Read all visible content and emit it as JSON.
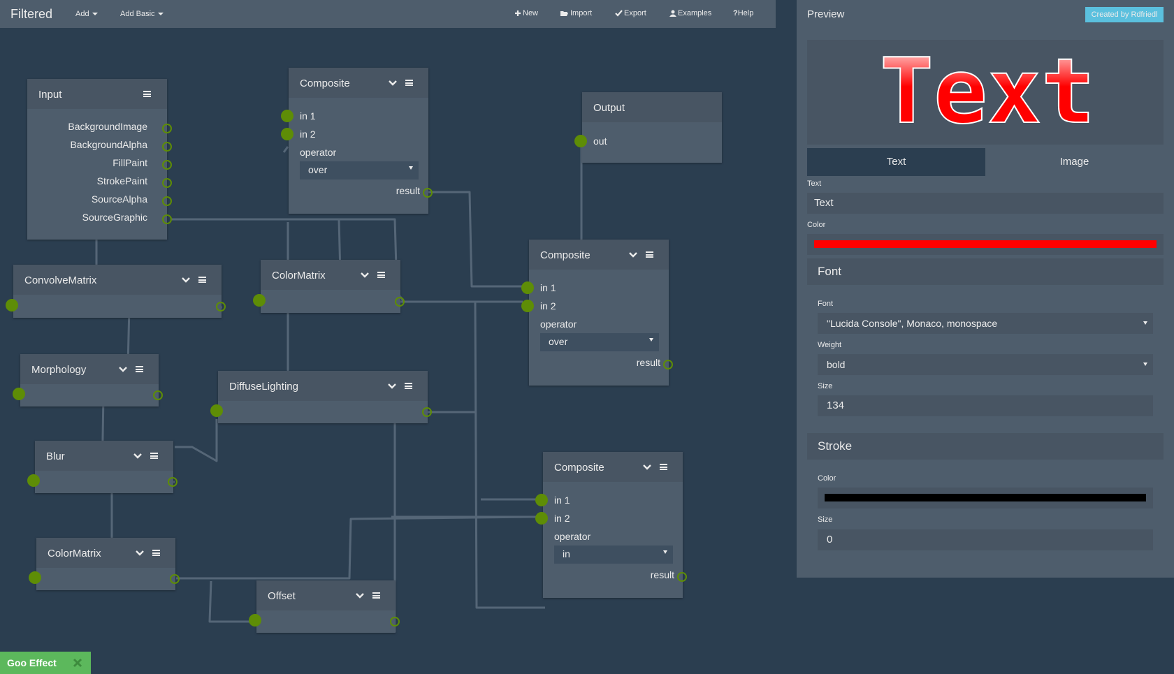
{
  "app": {
    "title": "Filtered"
  },
  "topmenu": {
    "add": "Add",
    "add_basic": "Add Basic"
  },
  "toolbar": {
    "new": "New",
    "import": "Import",
    "export": "Export",
    "examples": "Examples",
    "help": "Help"
  },
  "nodes": {
    "input": {
      "title": "Input",
      "outputs": [
        "BackgroundImage",
        "BackgroundAlpha",
        "FillPaint",
        "StrokePaint",
        "SourceAlpha",
        "SourceGraphic"
      ]
    },
    "composite1": {
      "title": "Composite",
      "in1": "in 1",
      "in2": "in 2",
      "operator_label": "operator",
      "operator": "over",
      "result": "result"
    },
    "output": {
      "title": "Output",
      "out": "out"
    },
    "convolve": {
      "title": "ConvolveMatrix"
    },
    "colormatrix1": {
      "title": "ColorMatrix"
    },
    "composite2": {
      "title": "Composite",
      "in1": "in 1",
      "in2": "in 2",
      "operator_label": "operator",
      "operator": "over",
      "result": "result"
    },
    "morphology": {
      "title": "Morphology"
    },
    "diffuse": {
      "title": "DiffuseLighting"
    },
    "blur": {
      "title": "Blur"
    },
    "composite3": {
      "title": "Composite",
      "in1": "in 1",
      "in2": "in 2",
      "operator_label": "operator",
      "operator": "in",
      "result": "result"
    },
    "colormatrix2": {
      "title": "ColorMatrix"
    },
    "offset": {
      "title": "Offset"
    }
  },
  "preview": {
    "header": "Preview",
    "badge": "Created by Rdfriedl",
    "sample_text": "Text",
    "tabs": [
      "Text",
      "Image"
    ],
    "text_label": "Text",
    "text_value": "Text",
    "color_label": "Color",
    "text_color": "#ff0000",
    "font_section": "Font",
    "font_label": "Font",
    "font_value": "\"Lucida Console\", Monaco, monospace",
    "weight_label": "Weight",
    "weight_value": "bold",
    "size_label": "Size",
    "size_value": "134",
    "stroke_section": "Stroke",
    "stroke_color_label": "Color",
    "stroke_color": "#000000",
    "stroke_size_label": "Size",
    "stroke_size_value": "0"
  },
  "footer": {
    "goo_label": "Goo Effect"
  },
  "colors": {
    "bg": "#2b3e50",
    "node": "#4e5d6c",
    "pin": "#5e8d06",
    "accent": "#5bc0de",
    "success": "#5cb85c"
  }
}
